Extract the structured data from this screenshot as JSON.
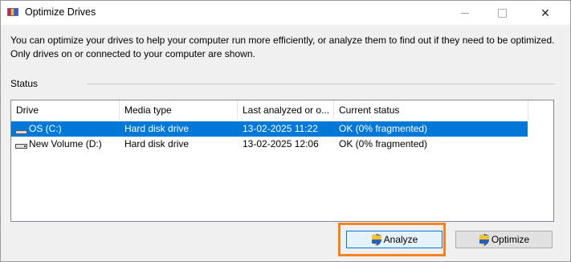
{
  "window": {
    "title": "Optimize Drives",
    "minimize_icon": "minimize-icon",
    "maximize_icon": "maximize-icon",
    "close_glyph": "✕"
  },
  "description": "You can optimize your drives to help your computer run more efficiently, or analyze them to find out if they need to be optimized. Only drives on or connected to your computer are shown.",
  "status": {
    "label": "Status",
    "columns": [
      "Drive",
      "Media type",
      "Last analyzed or o...",
      "Current status"
    ],
    "drives": [
      {
        "name": "OS (C:)",
        "media_type": "Hard disk drive",
        "last_analyzed": "13-02-2025 11:22",
        "current_status": "OK (0% fragmented)",
        "icon": "windows-drive-icon",
        "selected": true
      },
      {
        "name": "New Volume (D:)",
        "media_type": "Hard disk drive",
        "last_analyzed": "13-02-2025 12:06",
        "current_status": "OK (0% fragmented)",
        "icon": "drive-icon",
        "selected": false
      }
    ]
  },
  "buttons": {
    "analyze": "Analyze",
    "optimize": "Optimize"
  },
  "colors": {
    "selection": "#0078d7",
    "highlight": "#f58220"
  }
}
